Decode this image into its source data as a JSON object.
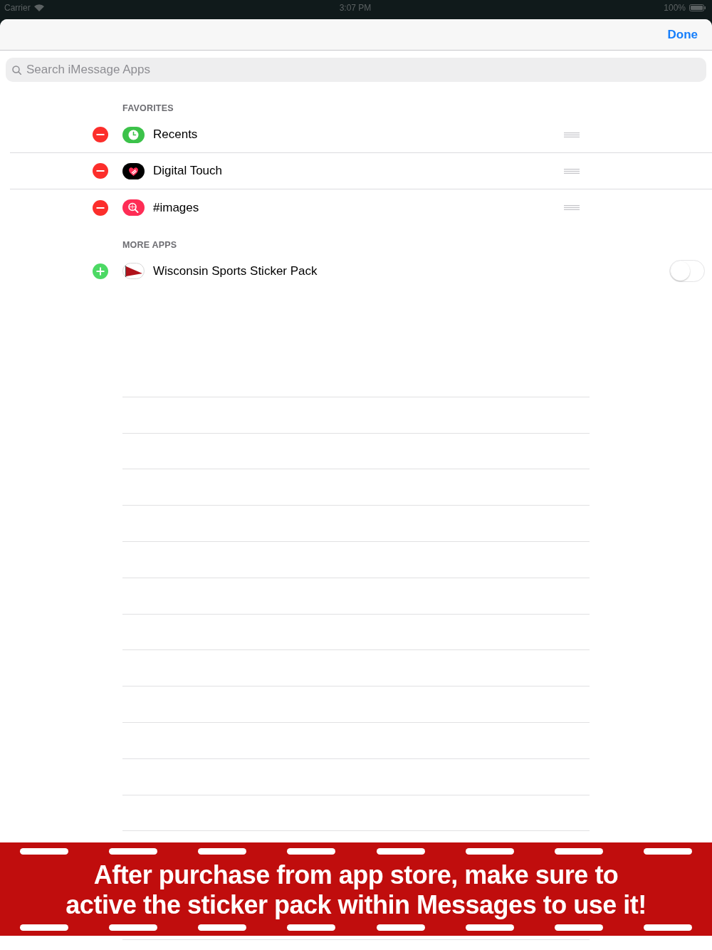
{
  "status_bar": {
    "carrier": "Carrier",
    "time": "3:07 PM",
    "battery": "100%"
  },
  "nav_bar": {
    "done_button": "Done"
  },
  "search": {
    "placeholder": "Search iMessage Apps"
  },
  "sections": [
    {
      "header": "FAVORITES",
      "items": [
        {
          "name": "Recents",
          "kind": "favorite"
        },
        {
          "name": "Digital Touch",
          "kind": "favorite"
        },
        {
          "name": "#images",
          "kind": "favorite"
        }
      ]
    },
    {
      "header": "MORE APPS",
      "items": [
        {
          "name": "Wisconsin Sports Sticker Pack",
          "kind": "available",
          "on": false
        }
      ]
    }
  ],
  "banner": {
    "message": "After purchase from app store, make sure to active the sticker pack within Messages to use it!"
  }
}
